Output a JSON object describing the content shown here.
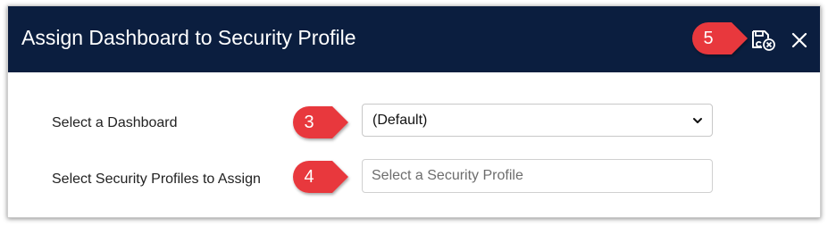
{
  "dialog": {
    "title": "Assign Dashboard to Security Profile",
    "header_color": "#0b1e3f",
    "save_cancel_icon": "save-cancel-icon",
    "close_icon": "close-icon"
  },
  "form": {
    "dashboard_label": "Select a Dashboard",
    "dashboard_value": "(Default)",
    "dashboard_chevron_icon": "chevron-down-icon",
    "profiles_label": "Select Security Profiles to Assign",
    "profiles_placeholder": "Select a Security Profile"
  },
  "callouts": [
    {
      "number": "3"
    },
    {
      "number": "4"
    },
    {
      "number": "5"
    }
  ],
  "colors": {
    "callout": "#e8383d",
    "accent_dark": "#0b1e3f"
  }
}
